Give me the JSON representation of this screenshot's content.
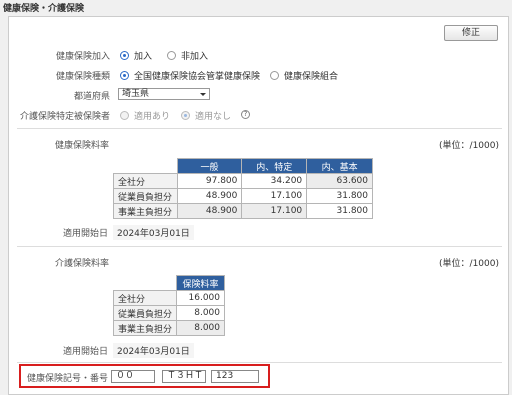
{
  "header": {
    "title": "健康保険・介護保険"
  },
  "edit_button": "修正",
  "form": {
    "enrollment": {
      "label": "健康保険加入",
      "options": [
        "加入",
        "非加入"
      ],
      "selected": "加入"
    },
    "type": {
      "label": "健康保険種類",
      "options": [
        "全国健康保険協会管掌健康保険",
        "健康保険組合"
      ],
      "selected": "全国健康保険協会管掌健康保険"
    },
    "prefecture": {
      "label": "都道府県",
      "value": "埼玉県"
    },
    "care_insured": {
      "label": "介護保険特定被保険者",
      "options": [
        "適用あり",
        "適用なし"
      ],
      "selected": "適用なし",
      "help": "?"
    }
  },
  "health_rate": {
    "title": "健康保険料率",
    "unit": "(単位：/1000)",
    "columns": [
      "一般",
      "内、特定",
      "内、基本"
    ],
    "rows": [
      {
        "label": "全社分",
        "values": [
          "97.800",
          "34.200",
          "63.600"
        ]
      },
      {
        "label": "従業員負担分",
        "values": [
          "48.900",
          "17.100",
          "31.800"
        ]
      },
      {
        "label": "事業主負担分",
        "values": [
          "48.900",
          "17.100",
          "31.800"
        ]
      }
    ],
    "start_label": "適用開始日",
    "start_date": "2024年03月01日"
  },
  "care_rate": {
    "title": "介護保険料率",
    "unit": "(単位：/1000)",
    "column": "保険料率",
    "rows": [
      {
        "label": "全社分",
        "value": "16.000"
      },
      {
        "label": "従業員負担分",
        "value": "8.000"
      },
      {
        "label": "事業主負担分",
        "value": "8.000"
      }
    ],
    "start_label": "適用開始日",
    "start_date": "2024年03月01日"
  },
  "symbol": {
    "label": "健康保険記号・番号",
    "field1": "００",
    "field2": "Ｔ３ＨＴ",
    "field3": "123"
  },
  "colors": {
    "header_blue": "#2f5f9e",
    "radio_blue": "#2d6bc7",
    "highlight_red": "#d81e1e"
  }
}
